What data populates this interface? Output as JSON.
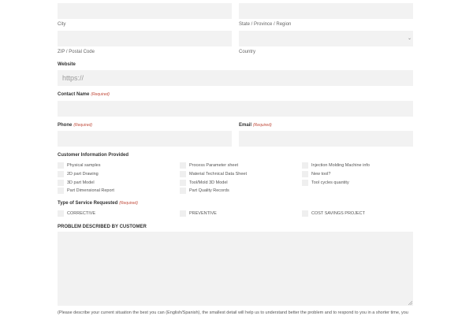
{
  "address": {
    "city_label": "City",
    "state_label": "State / Province / Region",
    "zip_label": "ZIP / Postal Code",
    "country_label": "Country"
  },
  "website": {
    "label": "Website",
    "placeholder": "https://"
  },
  "contact": {
    "label": "Contact Name",
    "required": "(Required)"
  },
  "phone": {
    "label": "Phone",
    "required": "(Required)"
  },
  "email": {
    "label": "Email",
    "required": "(Required)"
  },
  "customer_info": {
    "label": "Customer Information Provided",
    "options": [
      "Physical samples",
      "Process Parameter sheet",
      "Injection Molding Machine info",
      "2D part Drawing",
      "Material Technical Data Sheet",
      "New tool?",
      "3D part Model",
      "Tool/Mold 3D Model",
      "Tool cycles quantity",
      "Part Dimensional Report",
      "Part Quality Records"
    ]
  },
  "service": {
    "label": "Type of Service Requested",
    "required": "(Required)",
    "options": [
      "CORRECTIVE",
      "PREVENTIVE",
      "COST SAVINGS PROJECT"
    ]
  },
  "problem": {
    "label": "PROBLEM DESCRIBED BY CUSTOMER",
    "note": "(Please describe your current situation the best you can (English/Spanish), the smallest detail will help us to understand better the problem and to respond to you in a shorter time, you"
  }
}
